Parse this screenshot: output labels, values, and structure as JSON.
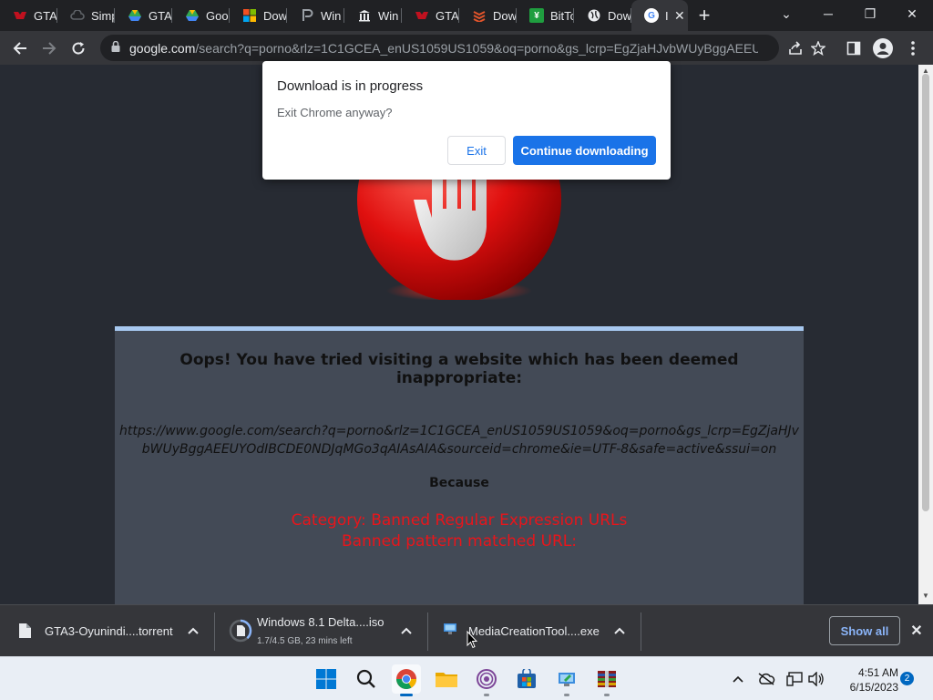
{
  "tabs": [
    {
      "label": "GTA",
      "icon": "gta-icon",
      "color": "#c0111f"
    },
    {
      "label": "Simp",
      "icon": "cloud-icon",
      "color": "#5f6368"
    },
    {
      "label": "GTA",
      "icon": "google-drive-icon",
      "color": "#34a853"
    },
    {
      "label": "Goo",
      "icon": "google-drive-icon",
      "color": "#fbbc04"
    },
    {
      "label": "Dow",
      "icon": "microsoft-icon",
      "color": "#f25022"
    },
    {
      "label": "Win",
      "icon": "p-icon",
      "color": "#5f6368"
    },
    {
      "label": "Win",
      "icon": "building-icon",
      "color": "#5f6368"
    },
    {
      "label": "GTA",
      "icon": "gta-icon",
      "color": "#c0111f"
    },
    {
      "label": "Dow",
      "icon": "stack-icon",
      "color": "#e2542b"
    },
    {
      "label": "BitTo",
      "icon": "bittorrent-icon",
      "color": "#1f9e3f"
    },
    {
      "label": "Dow",
      "icon": "globe-icon",
      "color": "#e8eaed"
    },
    {
      "label": "I",
      "icon": "google-icon",
      "color": "#4285f4"
    }
  ],
  "window_controls": {
    "minimize": "─",
    "restore": "❐",
    "close": "✕",
    "tab_search": "⌄"
  },
  "address_bar": {
    "domain": "google.com",
    "path": "/search?q=porno&rlz=1C1GCEA_enUS1059US1059&oq=porno&gs_lcrp=EgZjaHJvbWUyBggAEEUY..."
  },
  "dialog": {
    "title": "Download is in progress",
    "message": "Exit Chrome anyway?",
    "exit_label": "Exit",
    "continue_label": "Continue downloading"
  },
  "block_page": {
    "title": "Oops! You have tried visiting a website which has been deemed inappropriate:",
    "url_line1": "https://www.google.com/search?q=porno&rlz=1C1GCEA_enUS1059US1059&oq=porno&gs_lcrp=EgZjaHJv",
    "url_line2": "bWUyBggAEEUYOdIBCDE0NDJqMGo3qAIAsAIA&sourceid=chrome&ie=UTF-8&safe=active&ssui=on",
    "because": "Because",
    "category": "Category: Banned Regular Expression URLs",
    "reason": "Banned pattern matched URL:"
  },
  "downloads": [
    {
      "name": "GTA3-Oyunindi....torrent",
      "status": ""
    },
    {
      "name": "Windows 8.1 Delta....iso",
      "status": "1.7/4.5 GB, 23 mins left",
      "progress": 0.38
    },
    {
      "name": "MediaCreationTool....exe",
      "status": ""
    }
  ],
  "shelf": {
    "show_all_label": "Show all",
    "close": "✕"
  },
  "taskbar": {
    "apps": [
      "start-icon",
      "search-icon",
      "chrome-icon",
      "file-explorer-icon",
      "tor-icon",
      "microsoft-store-icon",
      "media-creation-icon",
      "winrar-icon"
    ],
    "time": "4:51 AM",
    "date": "6/15/2023",
    "notification_count": "2"
  },
  "colors": {
    "accent": "#1a73e8",
    "block_red": "#e8151b",
    "panel": "#434a56"
  }
}
